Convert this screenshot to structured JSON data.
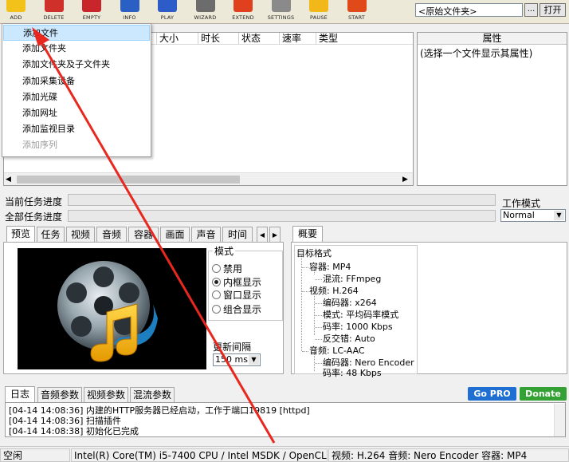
{
  "toolbar": {
    "buttons": [
      {
        "label": "ADD",
        "color": "#f2c21a",
        "icon": "add-icon"
      },
      {
        "label": "DELETE",
        "color": "#d0302a",
        "icon": "delete-icon"
      },
      {
        "label": "EMPTY",
        "color": "#c8262a",
        "icon": "empty-icon"
      },
      {
        "label": "INFO",
        "color": "#2a5fc4",
        "icon": "info-icon"
      },
      {
        "label": "PLAY",
        "color": "#2d5bc8",
        "icon": "play-icon"
      },
      {
        "label": "WIZARD",
        "color": "#6c6c6c",
        "icon": "wizard-icon"
      },
      {
        "label": "EXTEND",
        "color": "#e0401e",
        "icon": "extend-icon"
      },
      {
        "label": "SETTINGS",
        "color": "#8a8a8a",
        "icon": "settings-icon"
      },
      {
        "label": "PAUSE",
        "color": "#f2b81a",
        "icon": "pause-icon"
      },
      {
        "label": "START",
        "color": "#e04a1a",
        "icon": "start-icon"
      }
    ],
    "path_value": "<原始文件夹>",
    "browse_label": "...",
    "open_label": "打开"
  },
  "file_list": {
    "columns": [
      "大小",
      "时长",
      "状态",
      "速率",
      "类型"
    ]
  },
  "add_menu": {
    "items": [
      {
        "label": "添加文件",
        "state": "selected"
      },
      {
        "label": "添加文件夹",
        "state": "normal"
      },
      {
        "label": "添加文件夹及子文件夹",
        "state": "normal"
      },
      {
        "label": "添加采集设备",
        "state": "normal"
      },
      {
        "label": "添加光碟",
        "state": "normal"
      },
      {
        "label": "添加网址",
        "state": "normal"
      },
      {
        "label": "添加监视目录",
        "state": "normal"
      },
      {
        "label": "添加序列",
        "state": "disabled"
      }
    ]
  },
  "properties": {
    "header": "属性",
    "hint": "(选择一个文件显示其属性)"
  },
  "progress": {
    "current_label": "当前任务进度",
    "total_label": "全部任务进度",
    "current_value": 0,
    "total_value": 0
  },
  "work_mode": {
    "label": "工作模式",
    "value": "Normal"
  },
  "preview_tabs": [
    "预览",
    "任务",
    "视频",
    "音频",
    "容器",
    "画面",
    "声音",
    "时间"
  ],
  "tab_scroll": {
    "left": "◀",
    "right": "▶"
  },
  "summary_tab": "概要",
  "preview": {
    "mode_label": "模式",
    "modes": [
      {
        "label": "禁用",
        "checked": false
      },
      {
        "label": "内框显示",
        "checked": true
      },
      {
        "label": "窗口显示",
        "checked": false
      },
      {
        "label": "组合显示",
        "checked": false
      }
    ],
    "interval_label": "更新间隔",
    "interval_value": "150 ms"
  },
  "summary_tree": [
    {
      "text": "目标格式",
      "level": 0
    },
    {
      "text": "容器: MP4",
      "level": 1
    },
    {
      "text": "混流: FFmpeg",
      "level": 2
    },
    {
      "text": "视频: H.264",
      "level": 1
    },
    {
      "text": "编码器: x264",
      "level": 2
    },
    {
      "text": "模式: 平均码率模式",
      "level": 2
    },
    {
      "text": "码率: 1000 Kbps",
      "level": 2
    },
    {
      "text": "反交错: Auto",
      "level": 2
    },
    {
      "text": "音频: LC-AAC",
      "level": 1
    },
    {
      "text": "编码器: Nero Encoder",
      "level": 2
    },
    {
      "text": "码率: 48 Kbps",
      "level": 2
    }
  ],
  "log_tabs": [
    "日志",
    "音频参数",
    "视频参数",
    "混流参数"
  ],
  "log_lines": [
    "[04-14 14:08:36] 内建的HTTP服务器已经启动，工作于端口19819 [httpd]",
    "[04-14 14:08:36] 扫描插件",
    "[04-14 14:08:38] 初始化已完成"
  ],
  "buttons": {
    "gopro": "Go PRO",
    "donate": "Donate"
  },
  "statusbar": {
    "state": "空闲",
    "hardware": "Intel(R) Core(TM) i5-7400 CPU  / Intel MSDK / OpenCL",
    "format": "视频: H.264  音频: Nero Encoder  容器: MP4"
  },
  "colors": {
    "annotation_arrow": "#e8281e",
    "menu_highlight": "#cce8ff"
  }
}
